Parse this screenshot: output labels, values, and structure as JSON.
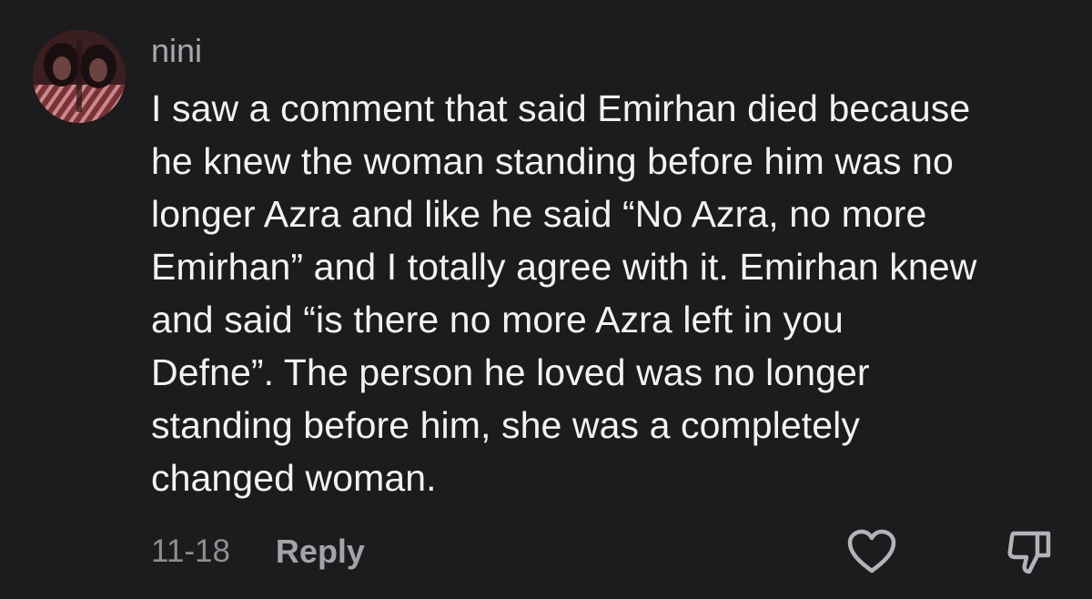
{
  "comment": {
    "username": "nini",
    "text": "I saw a comment that said Emirhan died because\nhe knew the woman standing before him was no\nlonger Azra and like he said “No Azra, no more\nEmirhan” and I totally agree with it. Emirhan knew\nand said “is there no more Azra left in you\nDefne”. The person he loved was no longer\nstanding before him, she was a completely\nchanged woman.",
    "date": "11-18",
    "reply_label": "Reply",
    "avatar_icon": "profile-photo",
    "like_icon": "heart-outline-icon",
    "dislike_icon": "thumbs-down-outline-icon"
  },
  "colors": {
    "background": "#1c1c1e",
    "text": "#f2f2f2",
    "username": "#a9a9ad",
    "muted": "#8e8e93"
  }
}
